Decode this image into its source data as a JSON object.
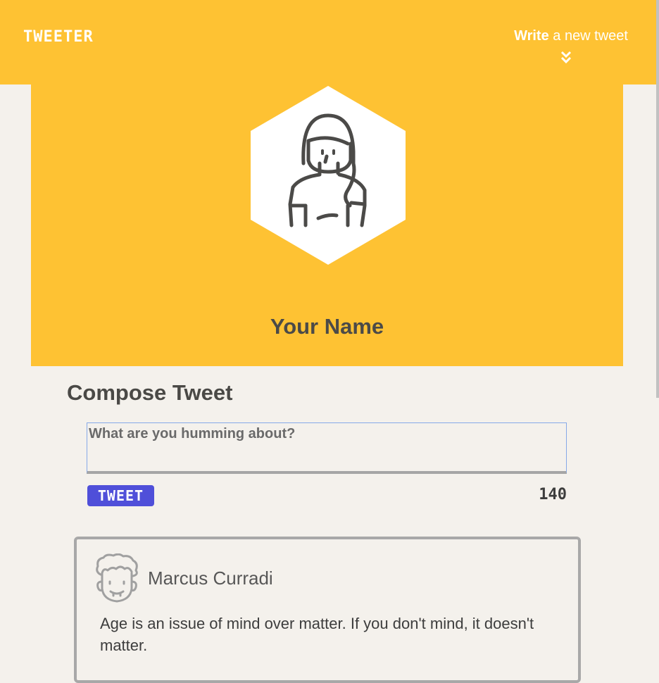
{
  "header": {
    "brand": "TWEETER",
    "write_bold": "Write",
    "write_rest": " a new tweet",
    "chevron_icon": "double-chevron-down-icon"
  },
  "profile": {
    "name": "Your Name",
    "avatar_icon": "user-woman-icon"
  },
  "compose": {
    "title": "Compose Tweet",
    "placeholder": "What are you humming about?",
    "button_label": "TWEET",
    "counter": "140"
  },
  "tweets": [
    {
      "author": "Marcus Curradi",
      "avatar_icon": "user-man-icon",
      "text": "Age is an issue of mind over matter. If you don't mind, it doesn't matter."
    }
  ],
  "colors": {
    "accent": "#fec233",
    "button": "#4f4fd9",
    "background": "#f4f1ec"
  }
}
